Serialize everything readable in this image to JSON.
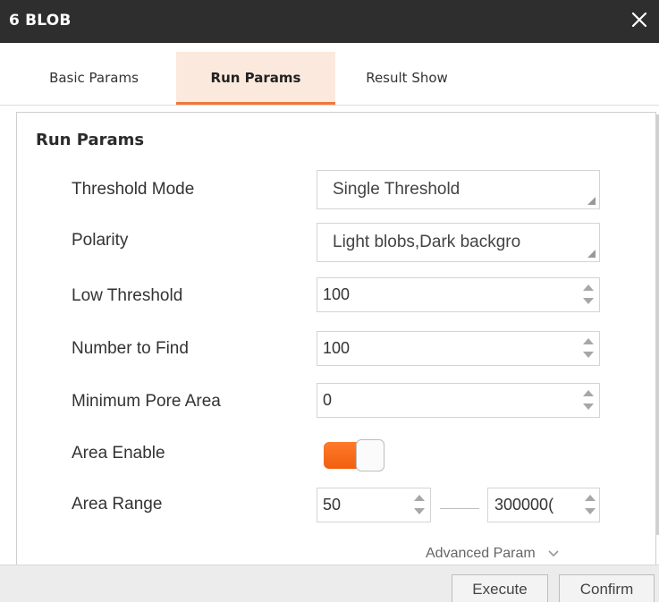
{
  "window": {
    "title": "6 BLOB",
    "close_icon": "close-icon"
  },
  "tabs": [
    {
      "label": "Basic Params",
      "active": false
    },
    {
      "label": "Run Params",
      "active": true
    },
    {
      "label": "Result Show",
      "active": false
    }
  ],
  "section": {
    "title": "Run Params"
  },
  "params": {
    "threshold_mode": {
      "label": "Threshold Mode",
      "value": "Single Threshold"
    },
    "polarity": {
      "label": "Polarity",
      "value": "Light blobs,Dark backgro"
    },
    "low_threshold": {
      "label": "Low Threshold",
      "value": "100"
    },
    "number_to_find": {
      "label": "Number to Find",
      "value": "100"
    },
    "min_pore_area": {
      "label": "Minimum Pore Area",
      "value": "0"
    },
    "area_enable": {
      "label": "Area Enable",
      "on": true
    },
    "area_range": {
      "label": "Area Range",
      "min": "50",
      "max": "300000("
    }
  },
  "advanced": {
    "label": "Advanced Param"
  },
  "footer": {
    "execute_label": "Execute",
    "confirm_label": "Confirm"
  },
  "colors": {
    "accent": "#f0773a",
    "titlebar": "#2e2e2e",
    "active_tab_bg": "#fbe9dd"
  }
}
